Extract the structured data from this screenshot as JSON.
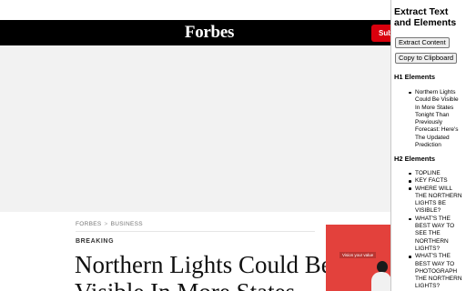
{
  "site": {
    "logo": "Forbes",
    "subscribe_label": "Subs",
    "breadcrumb": [
      "FORBES",
      "BUSINESS"
    ],
    "breadcrumb_separator": ">",
    "kicker": "BREAKING",
    "headline": "Northern Lights Could Be Visible In More States",
    "video_label": "Vision your value"
  },
  "extension": {
    "title": "Extract Text and Elements",
    "extract_button": "Extract Content",
    "copy_button": "Copy to Clipboard",
    "h1_heading": "H1 Elements",
    "h1_items": [
      "Northern Lights Could Be Visible In More States Tonight Than Previously Forecast: Here's The Updated Prediction"
    ],
    "h2_heading": "H2 Elements",
    "h2_items": [
      "TOPLINE",
      "KEY FACTS",
      "WHERE WILL THE NORTHERN LIGHTS BE VISIBLE?",
      "WHAT'S THE BEST WAY TO SEE THE NORTHERN LIGHTS?",
      "WHAT'S THE BEST WAY TO PHOTOGRAPH THE NORTHERN LIGHTS?"
    ]
  },
  "colors": {
    "forbes_bar": "#000000",
    "subscribe": "#d9000d",
    "video_bg": "#e3413c"
  }
}
